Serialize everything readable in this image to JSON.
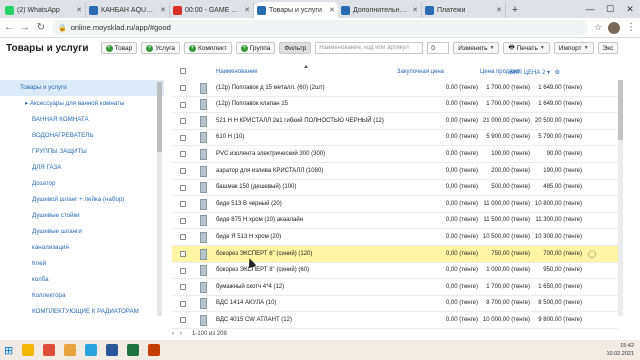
{
  "browser": {
    "tabs": [
      {
        "title": "(2) WhatsApp",
        "active": false,
        "color": "#25d366"
      },
      {
        "title": "КАНБАН AQUATAU",
        "active": false,
        "color": "#2a6ab0"
      },
      {
        "title": "00:00 - GAME OVER",
        "active": false,
        "color": "#d93025"
      },
      {
        "title": "Товары и услуги",
        "active": true,
        "color": "#2a6ab0"
      },
      {
        "title": "Дополнительные пол",
        "active": false,
        "color": "#2a6ab0"
      },
      {
        "title": "Платежи",
        "active": false,
        "color": "#2a6ab0"
      }
    ],
    "url": "online.moysklad.ru/app/#good"
  },
  "toolbar": {
    "page_title": "Товары и услуги",
    "buttons": {
      "product": "Товар",
      "service": "Услуга",
      "bundle": "Комплект",
      "group": "Группа",
      "filter": "Фильтр",
      "change": "Изменить",
      "print": "Печать",
      "import": "Импорт",
      "export": "Экс"
    },
    "search_placeholder": "Наименование, код или артикул",
    "quantity": "0"
  },
  "sidebar": {
    "items": [
      {
        "label": "Товары и услуги",
        "level": "root"
      },
      {
        "label": "▸ Аксессуары для ванной комнаты",
        "level": "sub"
      },
      {
        "label": "ВАННАЯ КОМНАТА",
        "level": "child"
      },
      {
        "label": "ВОДОНАГРЕВАТЕЛЬ",
        "level": "child"
      },
      {
        "label": "ГРУППЫ ЗАЩИТЫ",
        "level": "child"
      },
      {
        "label": "ДЛЯ ГАЗА",
        "level": "child"
      },
      {
        "label": "Дозатор",
        "level": "child"
      },
      {
        "label": "Душевой шланг + лейка (набор)",
        "level": "child"
      },
      {
        "label": "Душевые стойки",
        "level": "child"
      },
      {
        "label": "Душевые шланги",
        "level": "child"
      },
      {
        "label": "канализация",
        "level": "child"
      },
      {
        "label": "Клей",
        "level": "child"
      },
      {
        "label": "колба",
        "level": "child"
      },
      {
        "label": "Коллектора",
        "level": "child"
      },
      {
        "label": "КОМПЛЕКТУЮЩИЕ К РАДИАТОРАМ",
        "level": "child"
      }
    ]
  },
  "grid": {
    "headers": {
      "name": "Наименование",
      "purchase_price": "Закупочная цена",
      "sale_price": "Цена продажи",
      "vip_price": "ВИП ЦЕНА 2"
    },
    "rows": [
      {
        "name": "(12р) Поплавок д 15 металл. (60) (2шт)",
        "purchase": "0,00 (тенге)",
        "sale": "1 700,00 (тенге)",
        "vip": "1 649,00 (тенге)"
      },
      {
        "name": "(12р) Поплавок клапан 15",
        "purchase": "0,00 (тенге)",
        "sale": "1 700,00 (тенге)",
        "vip": "1 649,00 (тенге)"
      },
      {
        "name": "521 Н Н КРИСТАЛЛ 2в1 гибкий ПОЛНОСТЬЮ ЧЕРНЫЙ (12)",
        "purchase": "0,00 (тенге)",
        "sale": "21 000,00 (тенге)",
        "vip": "20 500,00 (тенге)"
      },
      {
        "name": "610 Н (10)",
        "purchase": "0,00 (тенге)",
        "sale": "5 900,00 (тенге)",
        "vip": "5 790,00 (тенге)"
      },
      {
        "name": "PVC изолента электрический 300 (300)",
        "purchase": "0,00 (тенге)",
        "sale": "100,00 (тенге)",
        "vip": "90,00 (тенге)"
      },
      {
        "name": "аэратор для излива КРИСТАЛЛ (1080)",
        "purchase": "0,00 (тенге)",
        "sale": "200,00 (тенге)",
        "vip": "190,00 (тенге)"
      },
      {
        "name": "башмак 150 (дешевый) (100)",
        "purchase": "0,00 (тенге)",
        "sale": "500,00 (тенге)",
        "vip": "485,00 (тенге)"
      },
      {
        "name": "биде 513 В черный (20)",
        "purchase": "0,00 (тенге)",
        "sale": "11 000,00 (тенге)",
        "vip": "10 800,00 (тенге)"
      },
      {
        "name": "биде 875 Н хром (10) акаалайн",
        "purchase": "0,00 (тенге)",
        "sale": "11 500,00 (тенге)",
        "vip": "11 300,00 (тенге)"
      },
      {
        "name": "биде Я 513 Н хром (20)",
        "purchase": "0,00 (тенге)",
        "sale": "10 500,00 (тенге)",
        "vip": "10 300,00 (тенге)"
      },
      {
        "name": "бокорез ЭКСПЕРТ 6\" (синий) (120)",
        "purchase": "0,00 (тенге)",
        "sale": "750,00 (тенге)",
        "vip": "700,00 (тенге)",
        "highlight": true
      },
      {
        "name": "бокорез ЭКСПЕРТ 8\" (синий) (60)",
        "purchase": "0,00 (тенге)",
        "sale": "1 000,00 (тенге)",
        "vip": "950,00 (тенге)"
      },
      {
        "name": "бумажный скотч 4*4 (12)",
        "purchase": "0,00 (тенге)",
        "sale": "1 700,00 (тенге)",
        "vip": "1 650,00 (тенге)"
      },
      {
        "name": "ВДС 1414 АКУЛА (10)",
        "purchase": "0,00 (тенге)",
        "sale": "8 700,00 (тенге)",
        "vip": "8 500,00 (тенге)"
      },
      {
        "name": "ВДС 4015 СW АТЛАНТ (12)",
        "purchase": "0,00 (тенге)",
        "sale": "10 000,00 (тенге)",
        "vip": "9 800,00 (тенге)"
      }
    ]
  },
  "footer": {
    "pagination": "1-100 из 208"
  },
  "taskbar": {
    "apps": [
      {
        "name": "file-explorer-icon",
        "color": "#f2b705"
      },
      {
        "name": "chrome-icon",
        "color": "#dd4b39"
      },
      {
        "name": "folder-icon",
        "color": "#e8a33d"
      },
      {
        "name": "telegram-icon",
        "color": "#2aa3df"
      },
      {
        "name": "word-icon",
        "color": "#2b579a"
      },
      {
        "name": "excel-icon",
        "color": "#217346"
      },
      {
        "name": "app-icon",
        "color": "#c43e00"
      }
    ],
    "time": "15:42",
    "date": "10.02.2021"
  }
}
